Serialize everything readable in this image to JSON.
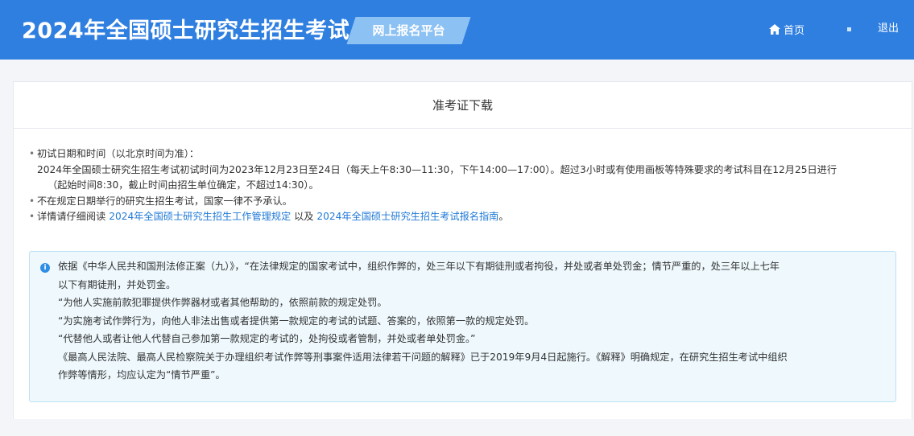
{
  "header": {
    "site_title": "2024年全国硕士研究生招生考试",
    "platform_label": "网上报名平台",
    "nav_home": "首页",
    "nav_logout": "退出"
  },
  "panel": {
    "title": "准考证下载",
    "notes": {
      "exam_time_label": "初试日期和时间（以北京时间为准）：",
      "exam_time_line1": "2024年全国硕士研究生招生考试初试时间为2023年12月23日至24日（每天上午8:30—11:30，下午14:00—17:00）。超过3小时或有使用画板等特殊要求的考试科目在12月25日进行",
      "exam_time_line2": "（起始时间8:30，截止时间由招生单位确定，不超过14:30）。",
      "not_scheduled": "不在规定日期举行的研究生招生考试，国家一律不予承认。",
      "read_prefix": "详情请仔细阅读",
      "link_rules": "2024年全国硕士研究生招生工作管理规定",
      "read_and": "以及",
      "link_guide": "2024年全国硕士研究生招生考试报名指南",
      "read_suffix": "。"
    },
    "law": {
      "line1": "依据《中华人民共和国刑法修正案（九）》，“在法律规定的国家考试中，组织作弊的，处三年以下有期徒刑或者拘役，并处或者单处罚金；情节严重的，处三年以上七年",
      "line2": "以下有期徒刑，并处罚金。",
      "line3": "“为他人实施前款犯罪提供作弊器材或者其他帮助的，依照前款的规定处罚。",
      "line4": "“为实施考试作弊行为，向他人非法出售或者提供第一款规定的考试的试题、答案的，依照第一款的规定处罚。",
      "line5": "“代替他人或者让他人代替自己参加第一款规定的考试的，处拘役或者管制，并处或者单处罚金。”",
      "line6": "《最高人民法院、最高人民检察院关于办理组织考试作弊等刑事案件适用法律若干问题的解释》已于2019年9月4日起施行。《解释》明确规定，在研究生招生考试中组织",
      "line7": "作弊等情形，均应认定为“情节严重”。"
    }
  },
  "icons": {
    "home": "home-icon",
    "info": "info-icon"
  },
  "colors": {
    "header_bg": "#2f7fe0",
    "badge_bg": "#8cc1f3",
    "link": "#1f79d6",
    "notice_bg": "#eef8fd",
    "notice_border": "#bde2f5"
  }
}
